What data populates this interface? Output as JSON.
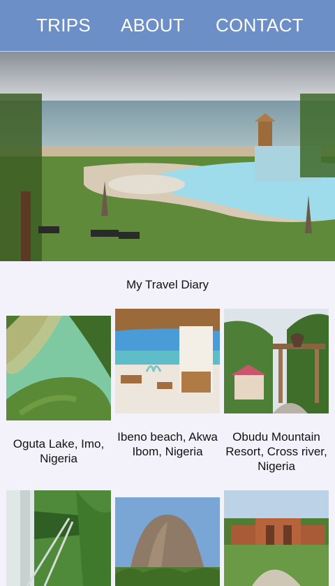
{
  "nav": {
    "items": [
      {
        "label": "TRIPS"
      },
      {
        "label": "ABOUT"
      },
      {
        "label": "CONTACT"
      }
    ]
  },
  "hero": {
    "image": "resort-pool-beach-photo"
  },
  "diary": {
    "title": "My Travel Diary"
  },
  "cards": [
    {
      "caption": "Oguta Lake, Imo, Nigeria",
      "image": "aerial-lake-photo"
    },
    {
      "caption": "Ibeno beach, Akwa Ibom, Nigeria",
      "image": "beach-cabana-photo"
    },
    {
      "caption": "Obudu Mountain Resort, Cross river, Nigeria",
      "image": "mountain-resort-gate-photo"
    },
    {
      "caption": "",
      "image": "canopy-walkway-photo"
    },
    {
      "caption": "",
      "image": "rock-mountain-photo"
    },
    {
      "caption": "",
      "image": "resort-building-photo"
    }
  ]
}
